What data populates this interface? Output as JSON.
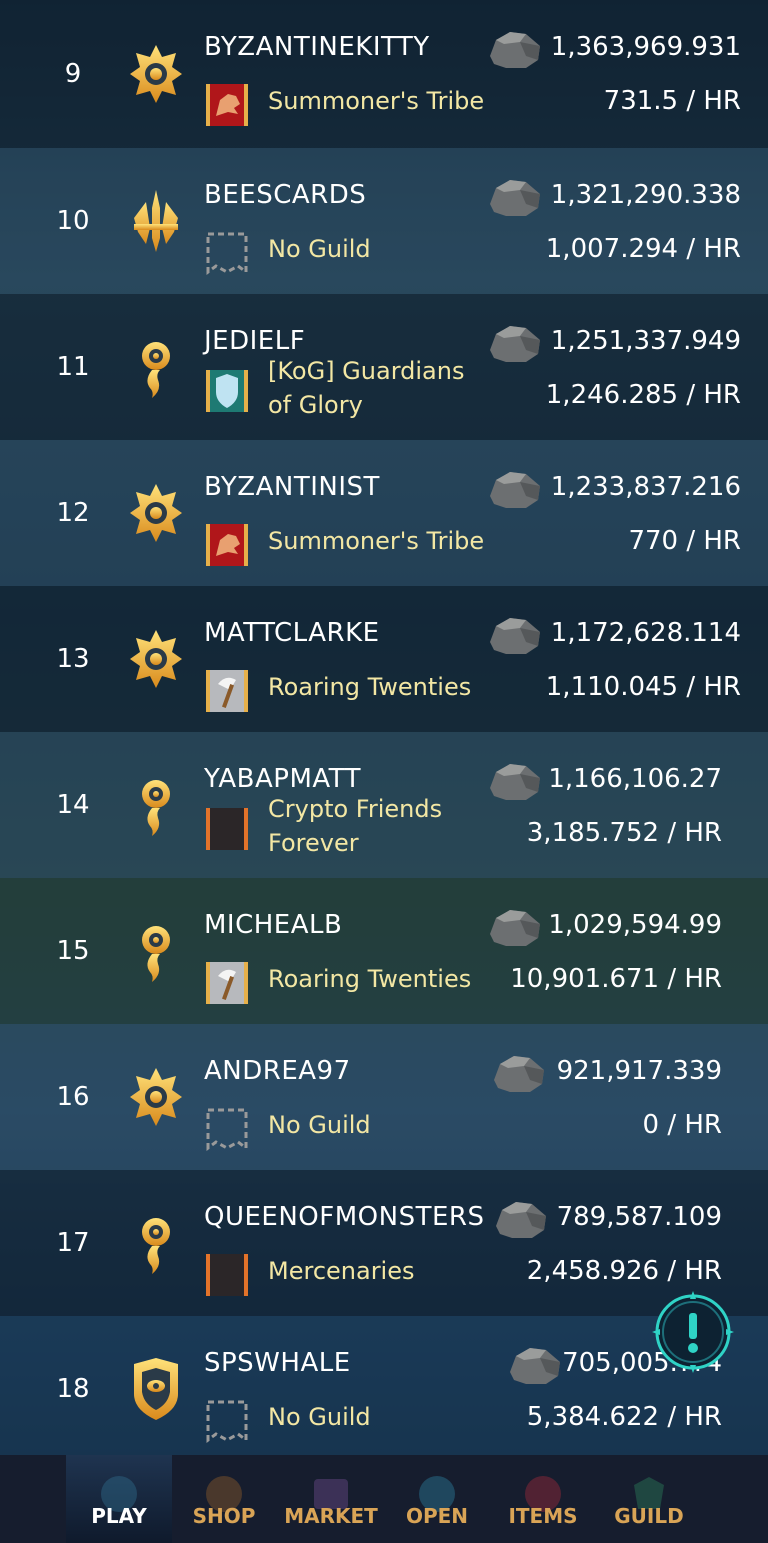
{
  "leaderboard": {
    "rows": [
      {
        "rank": "9",
        "player": "BYZANTINEKITTY",
        "guild": "Summoner's Tribe",
        "value": "1,363,969.931",
        "rate": "731.5 / HR"
      },
      {
        "rank": "10",
        "player": "BEESCARDS",
        "guild": "No Guild",
        "value": "1,321,290.338",
        "rate": "1,007.294 / HR"
      },
      {
        "rank": "11",
        "player": "JEDIELF",
        "guild_line1": "[KoG] Guardians",
        "guild_line2": "of Glory",
        "value": "1,251,337.949",
        "rate": "1,246.285 / HR"
      },
      {
        "rank": "12",
        "player": "BYZANTINIST",
        "guild": "Summoner's Tribe",
        "value": "1,233,837.216",
        "rate": "770 / HR"
      },
      {
        "rank": "13",
        "player": "MATTCLARKE",
        "guild": "Roaring Twenties",
        "value": "1,172,628.114",
        "rate": "1,110.045 / HR"
      },
      {
        "rank": "14",
        "player": "YABAPMATT",
        "guild_line1": "Crypto Friends",
        "guild_line2": "Forever",
        "value": "1,166,106.27",
        "rate": "3,185.752 / HR"
      },
      {
        "rank": "15",
        "player": "MICHEALB",
        "guild": "Roaring Twenties",
        "value": "1,029,594.99",
        "rate": "10,901.671 / HR"
      },
      {
        "rank": "16",
        "player": "ANDREA97",
        "guild": "No Guild",
        "value": "921,917.339",
        "rate": "0 / HR"
      },
      {
        "rank": "17",
        "player": "QUEENOFMONSTERS",
        "guild": "Mercenaries",
        "value": "789,587.109",
        "rate": "2,458.926 / HR"
      },
      {
        "rank": "18",
        "player": "SPSWHALE",
        "guild": "No Guild",
        "value": "705,005.??4",
        "rate": "5,384.622 / HR"
      }
    ]
  },
  "nav": {
    "play": "PLAY",
    "shop": "SHOP",
    "market": "MARKET",
    "open": "OPEN",
    "items": "ITEMS",
    "guild": "GUILD"
  },
  "colors": {
    "accent": "#d9a456",
    "guild_text": "#f3e7a4",
    "alert": "#2fd3c6"
  },
  "icons": [
    "gold-league-icon",
    "diamond-league-icon",
    "champion-league-icon",
    "silver-league-icon",
    "rock-icon",
    "guild-banner-icon",
    "alert-icon"
  ]
}
